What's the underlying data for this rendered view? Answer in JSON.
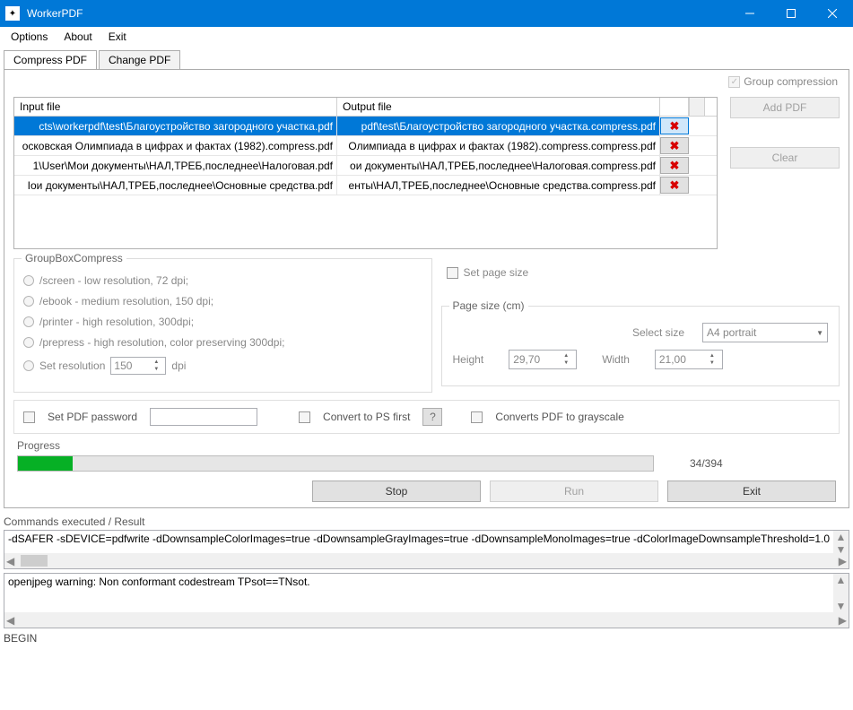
{
  "titlebar": {
    "title": "WorkerPDF"
  },
  "menu": {
    "options": "Options",
    "about": "About",
    "exit": "Exit"
  },
  "tabs": {
    "compress": "Compress PDF",
    "change": "Change PDF"
  },
  "group_compression_label": "Group compression",
  "grid": {
    "header_in": "Input file",
    "header_out": "Output file",
    "rows": [
      {
        "in": "cts\\workerpdf\\test\\Благоустройство загородного участка.pdf",
        "out": "pdf\\test\\Благоустройство загородного участка.compress.pdf"
      },
      {
        "in": "осковская Олимпиада в цифрах и фактах (1982).compress.pdf",
        "out": "Олимпиада в цифрах и фактах (1982).compress.compress.pdf"
      },
      {
        "in": "1\\User\\Мои документы\\НАЛ,ТРЕБ,последнее\\Налоговая.pdf",
        "out": "ои документы\\НАЛ,ТРЕБ,последнее\\Налоговая.compress.pdf"
      },
      {
        "in": "Іои документы\\НАЛ,ТРЕБ,последнее\\Основные средства.pdf",
        "out": "енты\\НАЛ,ТРЕБ,последнее\\Основные средства.compress.pdf"
      }
    ]
  },
  "side": {
    "add": "Add PDF",
    "clear": "Clear"
  },
  "compress": {
    "title": "GroupBoxCompress",
    "screen": "/screen - low resolution, 72 dpi;",
    "ebook": "/ebook - medium resolution, 150 dpi;",
    "printer": "/printer - high resolution, 300dpi;",
    "prepress": "/prepress - high resolution, color preserving 300dpi;",
    "setres": "Set resolution",
    "res_value": "150",
    "dpi": "dpi"
  },
  "pagesize": {
    "set_label": "Set page size",
    "group_title": "Page size (cm)",
    "select_label": "Select size",
    "select_value": "A4 portrait",
    "height_label": "Height",
    "height_value": "29,70",
    "width_label": "Width",
    "width_value": "21,00"
  },
  "opts": {
    "set_pw": "Set PDF password",
    "convert_ps": "Convert to PS first",
    "q": "?",
    "grayscale": "Converts PDF to grayscale"
  },
  "progress": {
    "label": "Progress",
    "text": "34/394",
    "percent": 8.6
  },
  "actions": {
    "stop": "Stop",
    "run": "Run",
    "exit": "Exit"
  },
  "cmds": {
    "label": "Commands executed / Result",
    "line": "-dSAFER -sDEVICE=pdfwrite -dDownsampleColorImages=true -dDownsampleGrayImages=true -dDownsampleMonoImages=true -dColorImageDownsampleThreshold=1.0"
  },
  "log": {
    "line": "openjpeg warning: Non conformant codestream TPsot==TNsot."
  },
  "status": "BEGIN"
}
